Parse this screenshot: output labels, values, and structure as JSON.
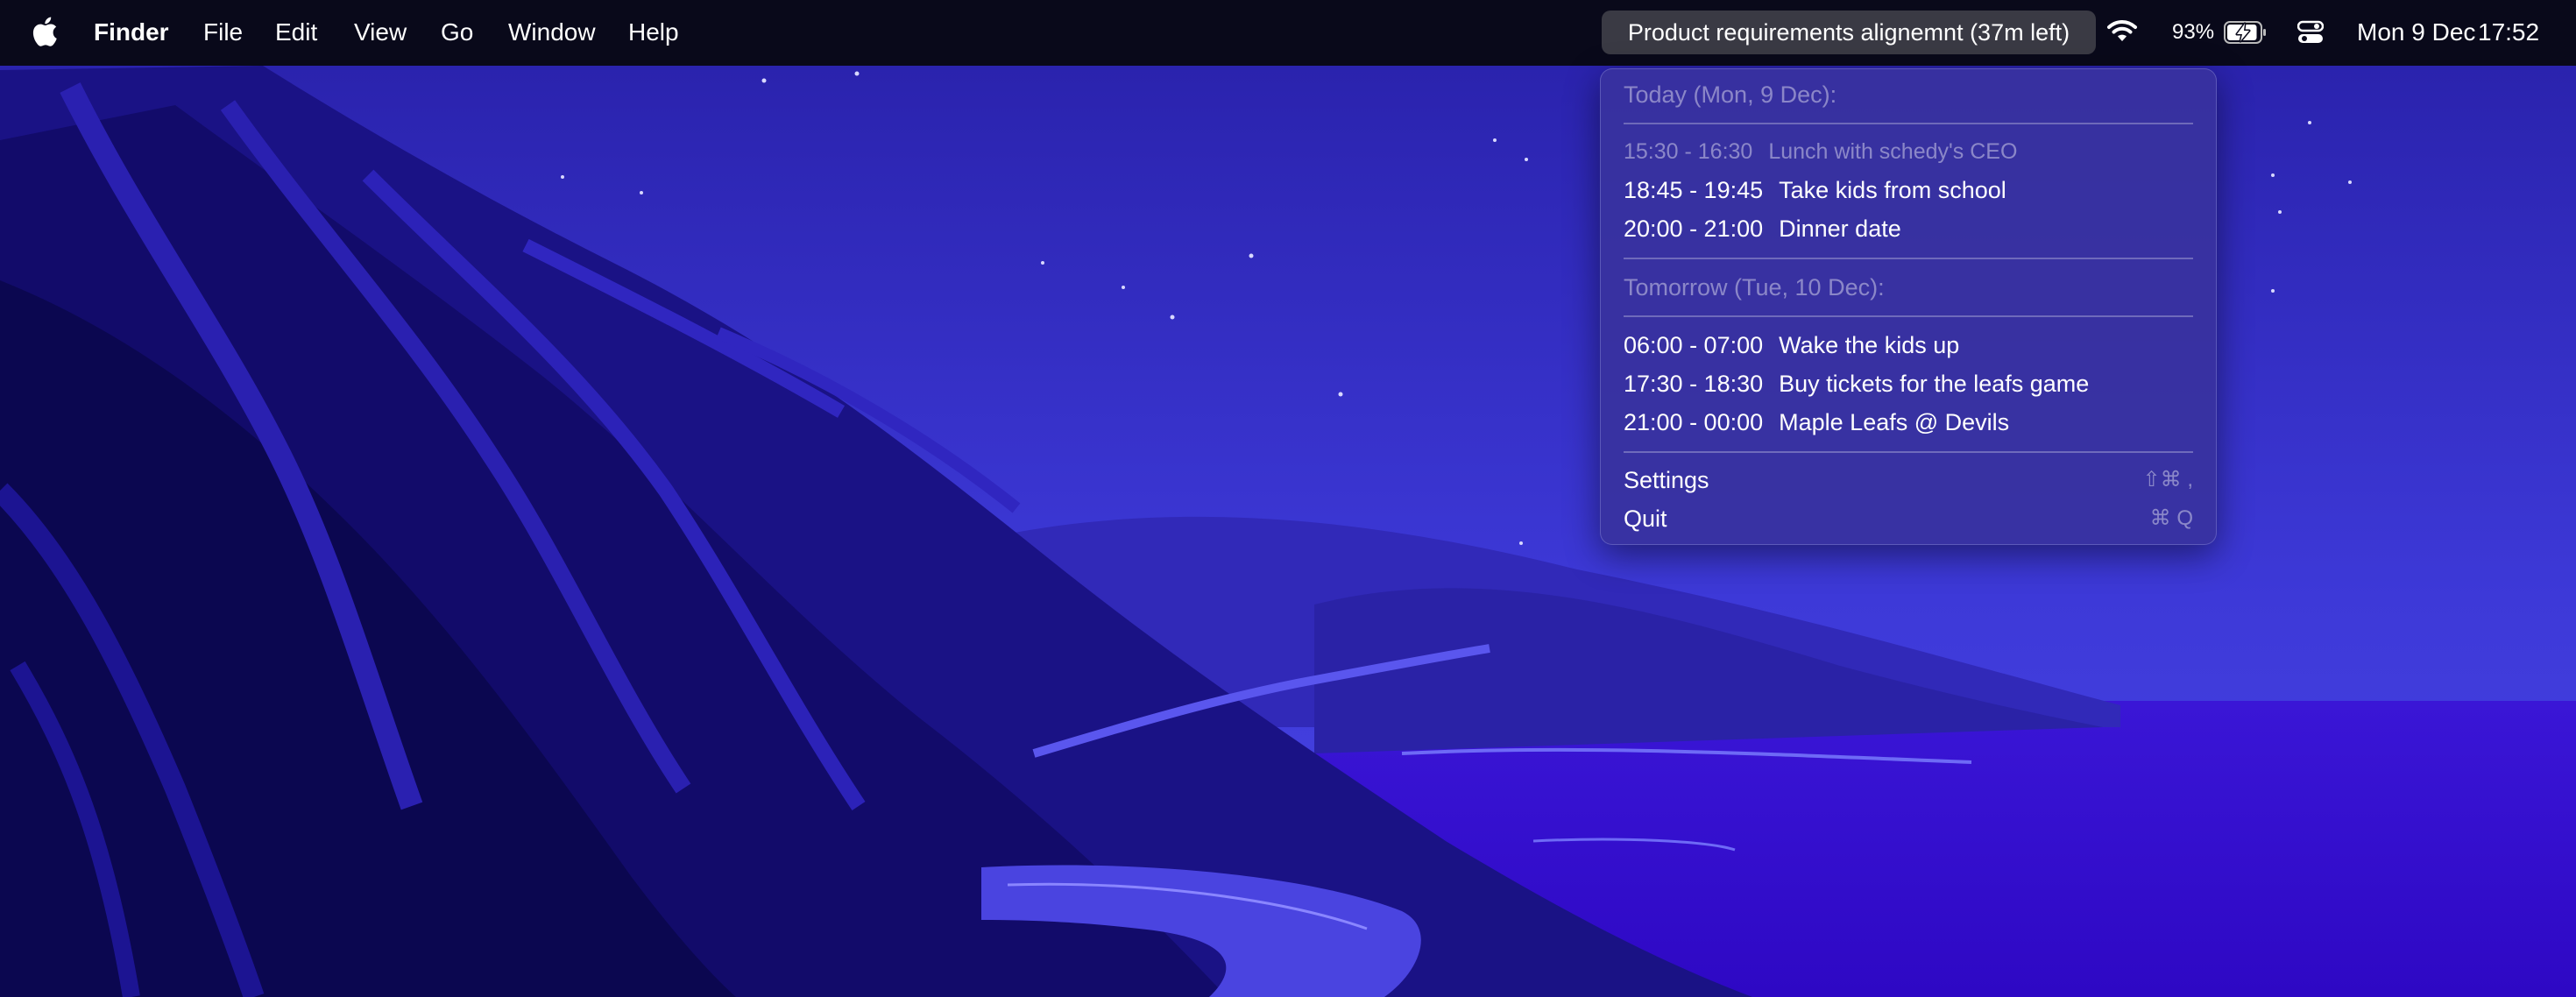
{
  "menubar": {
    "apple_icon": "apple-logo-icon",
    "app_name": "Finder",
    "menus": [
      "File",
      "Edit",
      "View",
      "Go",
      "Window",
      "Help"
    ],
    "meeting_pill": "Product requirements alignemnt (37m left)",
    "wifi_icon": "wifi-icon",
    "battery_percent": "93%",
    "battery_icon": "battery-charging-icon",
    "battery_level": 0.93,
    "control_center_icon": "control-center-icon",
    "date": "Mon 9 Dec",
    "time": "17:52"
  },
  "dropdown": {
    "today_header": "Today (Mon, 9 Dec):",
    "today_events": [
      {
        "time": "15:30 - 16:30",
        "title": "Lunch with schedy's CEO",
        "past": true
      },
      {
        "time": "18:45 - 19:45",
        "title": "Take kids from school",
        "past": false
      },
      {
        "time": "20:00 - 21:00",
        "title": "Dinner date",
        "past": false
      }
    ],
    "tomorrow_header": "Tomorrow (Tue, 10 Dec):",
    "tomorrow_events": [
      {
        "time": "06:00 - 07:00",
        "title": "Wake the kids up"
      },
      {
        "time": "17:30 - 18:30",
        "title": "Buy tickets for the leafs game"
      },
      {
        "time": "21:00 - 00:00",
        "title": "Maple Leafs @ Devils"
      }
    ],
    "settings_label": "Settings",
    "settings_shortcut": "⇧⌘ ,",
    "quit_label": "Quit",
    "quit_shortcut": "⌘ Q"
  },
  "colors": {
    "menubar_bg": "#09091a",
    "dropdown_bg": "#38329e",
    "wallpaper_sky": "#3a34d6",
    "wallpaper_sea": "#3512d0"
  }
}
